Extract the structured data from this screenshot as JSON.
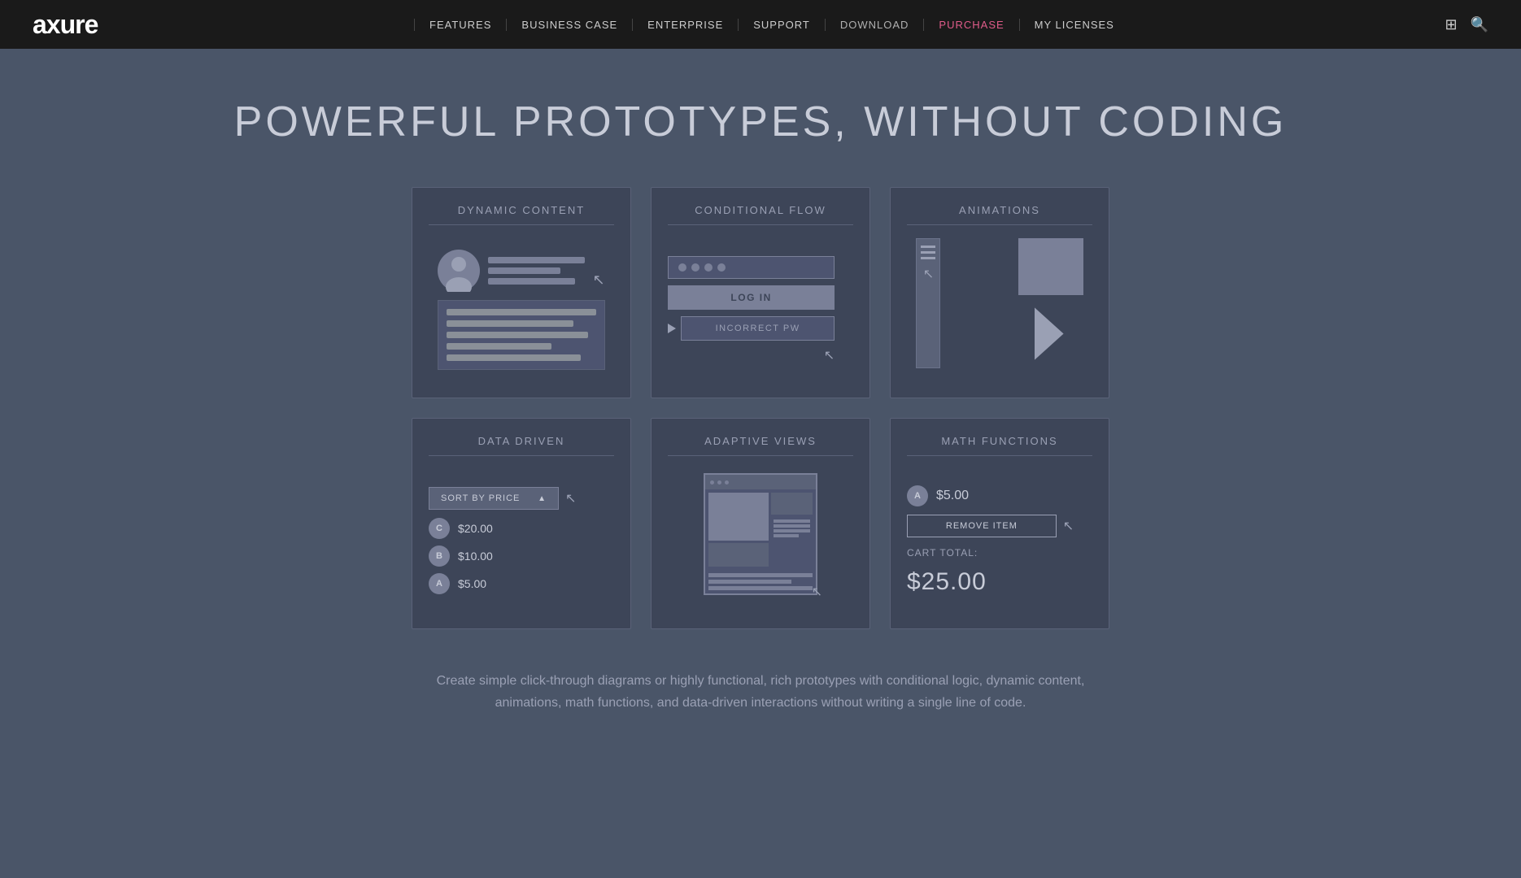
{
  "header": {
    "logo": "axure",
    "nav": [
      {
        "label": "FEATURES",
        "href": "#",
        "class": ""
      },
      {
        "label": "BUSINESS CASE",
        "href": "#",
        "class": ""
      },
      {
        "label": "ENTERPRISE",
        "href": "#",
        "class": ""
      },
      {
        "label": "SUPPORT",
        "href": "#",
        "class": ""
      },
      {
        "label": "DOWNLOAD",
        "href": "#",
        "class": "download"
      },
      {
        "label": "PURCHASE",
        "href": "#",
        "class": "purchase"
      },
      {
        "label": "MY LICENSES",
        "href": "#",
        "class": "mylicenses"
      }
    ]
  },
  "main": {
    "title": "POWERFUL PROTOTYPES, WITHOUT CODING",
    "cards": [
      {
        "id": "dynamic-content",
        "title": "DYNAMIC CONTENT"
      },
      {
        "id": "conditional-flow",
        "title": "CONDITIONAL FLOW",
        "log_in": "LOG IN",
        "incorrect_pw": "INCORRECT PW"
      },
      {
        "id": "animations",
        "title": "ANIMATIONS"
      },
      {
        "id": "data-driven",
        "title": "DATA DRIVEN",
        "sort_label": "SORT BY PRICE",
        "items": [
          {
            "badge": "C",
            "price": "$20.00"
          },
          {
            "badge": "B",
            "price": "$10.00"
          },
          {
            "badge": "A",
            "price": "$5.00"
          }
        ]
      },
      {
        "id": "adaptive-views",
        "title": "ADAPTIVE VIEWS"
      },
      {
        "id": "math-functions",
        "title": "MATH FUNCTIONS",
        "item_badge": "A",
        "item_price": "$5.00",
        "remove_btn": "REMOVE ITEM",
        "cart_total_label": "CART TOTAL:",
        "cart_total": "$25.00"
      }
    ],
    "description": "Create simple click-through diagrams or highly functional, rich prototypes with conditional logic, dynamic content, animations, math functions, and data-driven interactions without writing a single line of code."
  }
}
